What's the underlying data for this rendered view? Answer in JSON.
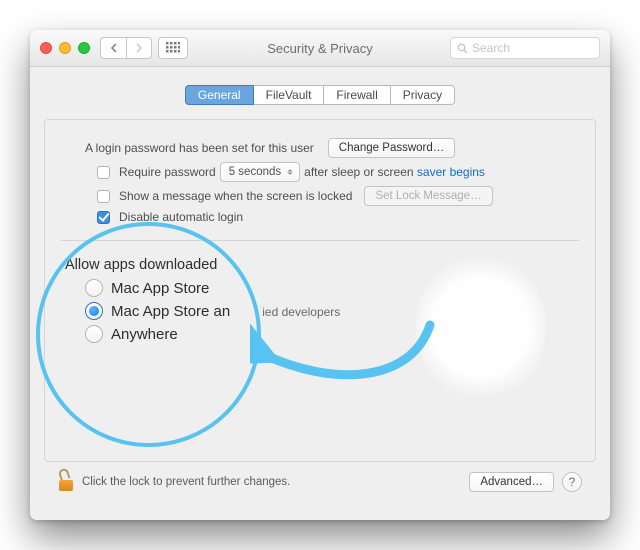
{
  "titlebar": {
    "title": "Security & Privacy",
    "search_placeholder": "Search"
  },
  "tabs": {
    "general": "General",
    "filevault": "FileVault",
    "firewall": "Firewall",
    "privacy": "Privacy"
  },
  "login": {
    "text": "A login password has been set for this user",
    "change_btn": "Change Password…",
    "require_label": "Require password",
    "require_select": "5 seconds",
    "require_suffix1": "after sleep or screen ",
    "require_suffix2": "saver begins",
    "show_msg_label": "Show a message when the screen is locked",
    "set_lock_btn": "Set Lock Message…",
    "disable_auto": "Disable automatic login"
  },
  "allow": {
    "title": "Allow apps downloaded from:",
    "title_trunc": "Allow apps downloaded",
    "opt1": "Mac App Store",
    "opt2_full": "Mac App Store and identified developers",
    "opt2_part1": "Mac App Store an",
    "opt2_part2": "ied developers",
    "opt3": "Anywhere"
  },
  "footer": {
    "lock_text": "Click the lock to prevent further changes.",
    "advanced": "Advanced…",
    "help": "?"
  }
}
